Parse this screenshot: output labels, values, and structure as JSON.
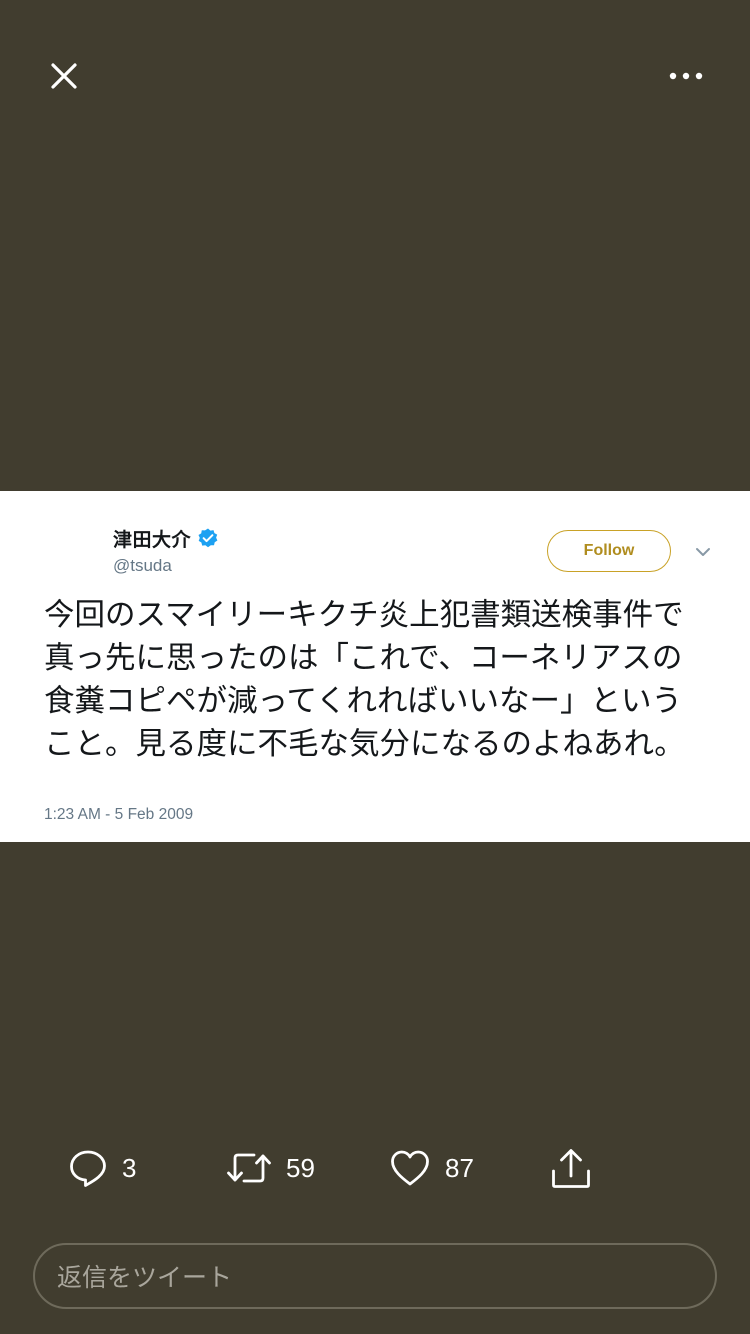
{
  "header": {
    "close_icon": "close-icon",
    "more_icon": "more-icon"
  },
  "tweet": {
    "author": {
      "display_name": "津田大介",
      "handle": "@tsuda",
      "verified": true
    },
    "follow_label": "Follow",
    "text": "今回のスマイリーキクチ炎上犯書類送検事件で真っ先に思ったのは「これで、コーネリアスの食糞コピペが減ってくれればいいなー」ということ。見る度に不毛な気分になるのよねあれ。",
    "timestamp": "1:23 AM - 5 Feb 2009"
  },
  "actions": {
    "reply_count": "3",
    "retweet_count": "59",
    "like_count": "87"
  },
  "reply_box": {
    "placeholder": "返信をツイート"
  },
  "colors": {
    "background": "#413d2f",
    "card": "#ffffff",
    "follow_accent": "#c9a227",
    "verified_blue": "#1da1f2",
    "secondary_text": "#657786"
  }
}
